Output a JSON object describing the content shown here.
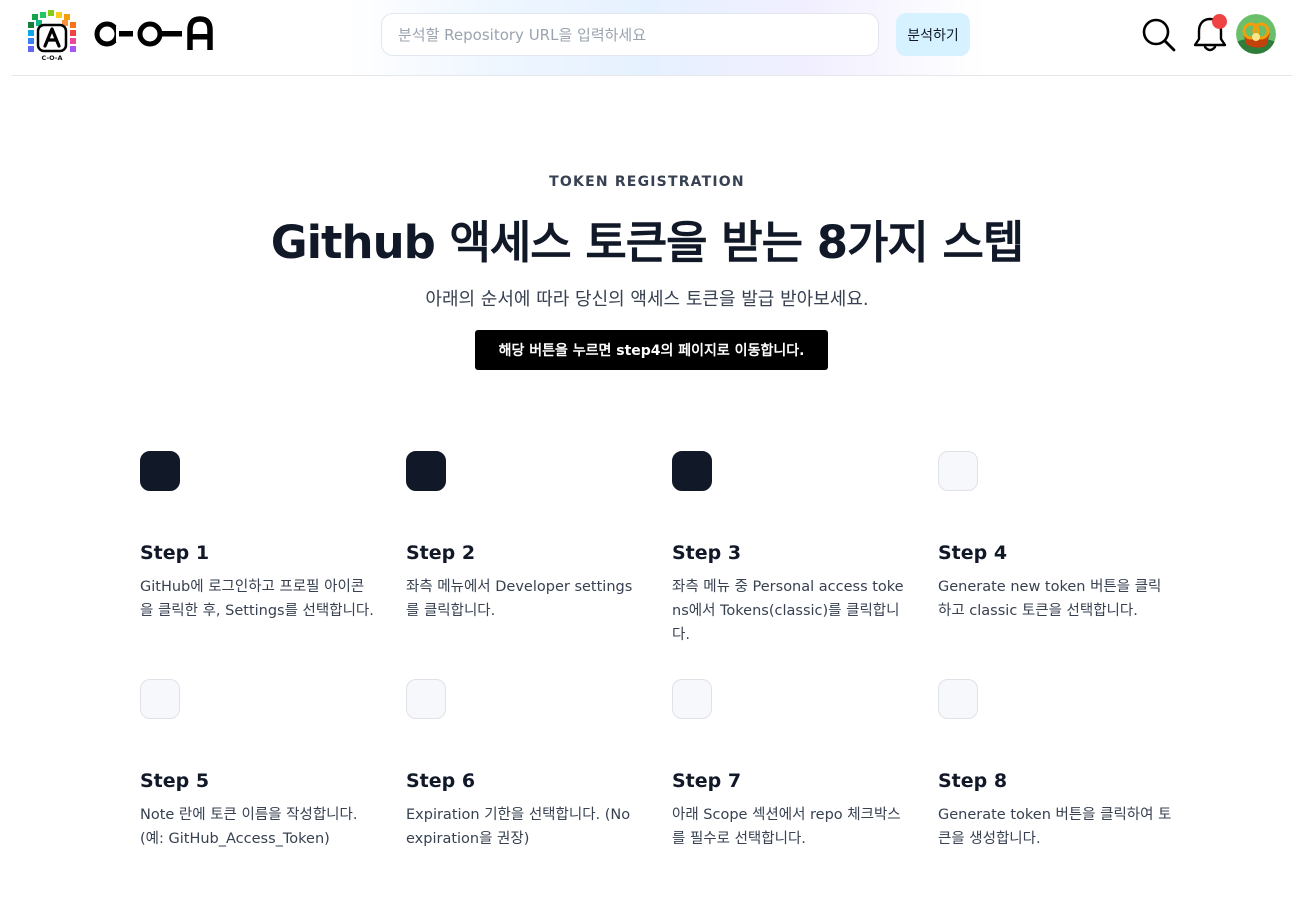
{
  "header": {
    "logo_mark_text": "C-O-A",
    "logo_text": "C-O-A",
    "search_placeholder": "분석할 Repository URL을 입력하세요",
    "search_value": "",
    "analyze_label": "분석하기",
    "notification_badge": true,
    "colors": {
      "analyze_bg": "#d6f1ff",
      "badge": "#ef4444"
    },
    "icons": [
      "search-icon",
      "bell-icon",
      "avatar"
    ]
  },
  "hero": {
    "eyebrow": "TOKEN REGISTRATION",
    "title": "Github 액세스 토큰을 받는 8가지 스텝",
    "subtitle": "아래의 순서에 따라 당신의 액세스 토큰을 발급 받아보세요.",
    "cta_label": "해당 버튼을 누르면 step4의 페이지로 이동합니다."
  },
  "steps": [
    {
      "title": "Step 1",
      "completed": true,
      "description": "GitHub에 로그인하고 프로필 아이콘을 클릭한 후, Settings를 선택합니다."
    },
    {
      "title": "Step 2",
      "completed": true,
      "description": "좌측 메뉴에서 Developer settings를 클릭합니다."
    },
    {
      "title": "Step 3",
      "completed": true,
      "description": "좌측 메뉴 중 Personal access tokens에서 Tokens(classic)를 클릭합니다."
    },
    {
      "title": "Step 4",
      "completed": false,
      "description": "Generate new token 버튼을 클릭하고 classic 토큰을 선택합니다."
    },
    {
      "title": "Step 5",
      "completed": false,
      "description": "Note 란에 토큰 이름을 작성합니다. (예: GitHub_Access_Token)"
    },
    {
      "title": "Step 6",
      "completed": false,
      "description": "Expiration 기한을 선택합니다. (No expiration을 권장)"
    },
    {
      "title": "Step 7",
      "completed": false,
      "description": "아래 Scope 섹션에서 repo 체크박스를 필수로 선택합니다."
    },
    {
      "title": "Step 8",
      "completed": false,
      "description": "Generate token 버튼을 클릭하여 토큰을 생성합니다."
    }
  ]
}
